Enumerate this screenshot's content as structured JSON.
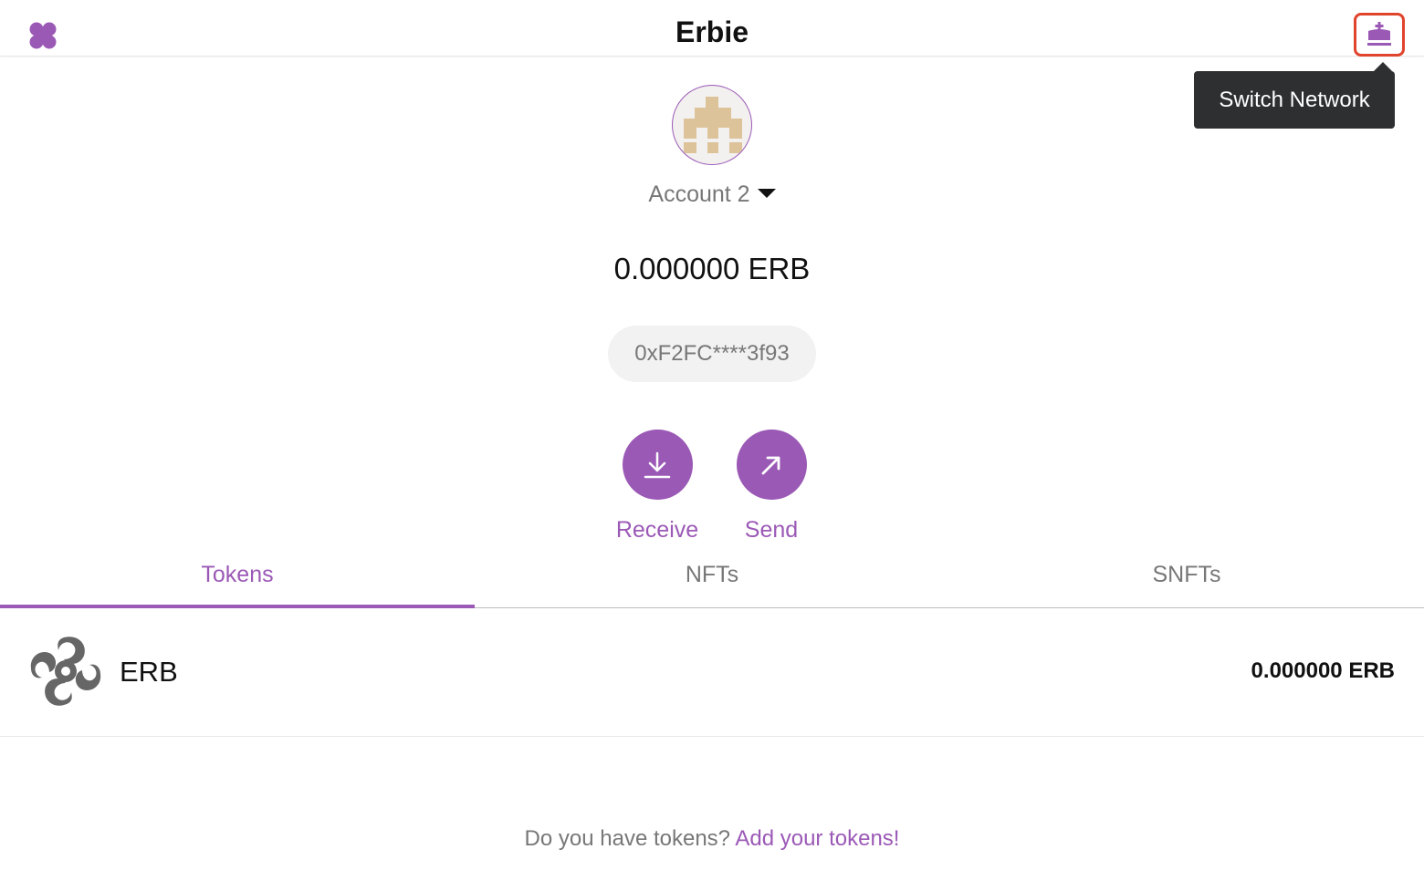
{
  "header": {
    "title": "Erbie",
    "logo_icon": "four-petal-logo-icon",
    "network_icon": "crown-icon",
    "tooltip": "Switch Network"
  },
  "account": {
    "name": "Account 2",
    "balance": "0.000000 ERB",
    "address": "0xF2FC****3f93"
  },
  "actions": {
    "receive_label": "Receive",
    "receive_icon": "download-icon",
    "send_label": "Send",
    "send_icon": "arrow-up-right-icon"
  },
  "tabs": [
    {
      "label": "Tokens",
      "active": true
    },
    {
      "label": "NFTs",
      "active": false
    },
    {
      "label": "SNFTs",
      "active": false
    }
  ],
  "tokens": [
    {
      "symbol": "ERB",
      "balance": "0.000000 ERB",
      "icon": "erb-token-icon"
    }
  ],
  "footer": {
    "prompt": "Do you have tokens?",
    "link": "Add your tokens!"
  },
  "colors": {
    "accent": "#9b59b6",
    "highlight_border": "#e0442c",
    "tooltip_bg": "#2e2f31",
    "muted_text": "#777777"
  }
}
